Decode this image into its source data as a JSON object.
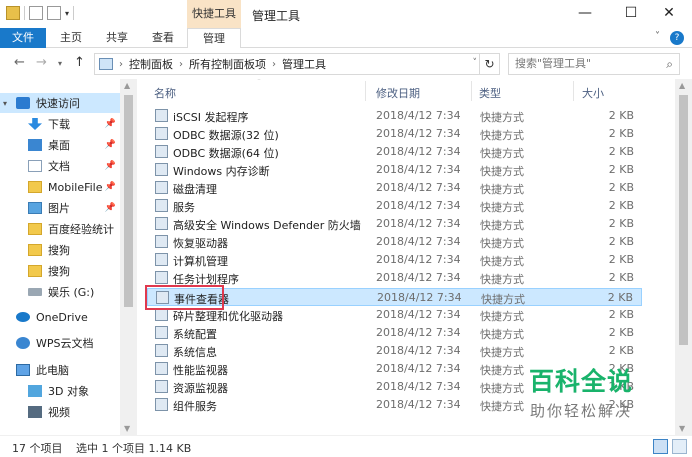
{
  "window": {
    "title": "管理工具",
    "context_tab": "快捷工具",
    "minimize_glyph": "—",
    "maximize_glyph": "☐",
    "close_glyph": "✕"
  },
  "ribbon": {
    "tabs": [
      {
        "label": "文件",
        "active": true
      },
      {
        "label": "主页"
      },
      {
        "label": "共享"
      },
      {
        "label": "查看"
      },
      {
        "label": "管理"
      }
    ],
    "collapse_glyph": "˅",
    "help_glyph": "?"
  },
  "address": {
    "segments": [
      "控制面板",
      "所有控制面板项",
      "管理工具"
    ],
    "search_placeholder": "搜索\"管理工具\""
  },
  "sidebar": {
    "items": [
      {
        "label": "快速访问",
        "icon": "star-icon",
        "selected": true
      },
      {
        "label": "下载",
        "icon": "download-icon",
        "pinned": true
      },
      {
        "label": "桌面",
        "icon": "desktop-icon",
        "pinned": true
      },
      {
        "label": "文档",
        "icon": "document-icon",
        "pinned": true
      },
      {
        "label": "MobileFile",
        "icon": "folder-icon",
        "pinned": true
      },
      {
        "label": "图片",
        "icon": "picture-icon",
        "pinned": true
      },
      {
        "label": "百度经验统计",
        "icon": "folder-icon"
      },
      {
        "label": "搜狗",
        "icon": "folder-icon"
      },
      {
        "label": "搜狗",
        "icon": "folder-icon"
      },
      {
        "label": "娱乐 (G:)",
        "icon": "drive-icon"
      },
      {
        "label": "OneDrive",
        "icon": "cloud-icon"
      },
      {
        "label": "WPS云文档",
        "icon": "wps-icon"
      },
      {
        "label": "此电脑",
        "icon": "computer-icon"
      },
      {
        "label": "3D 对象",
        "icon": "3d-objects-icon"
      },
      {
        "label": "视频",
        "icon": "video-icon"
      }
    ]
  },
  "columns": {
    "name": "名称",
    "modified": "修改日期",
    "type": "类型",
    "size": "大小"
  },
  "files": [
    {
      "name": "iSCSI 发起程序",
      "date": "2018/4/12 7:34",
      "type": "快捷方式",
      "size": "2 KB"
    },
    {
      "name": "ODBC 数据源(32 位)",
      "date": "2018/4/12 7:34",
      "type": "快捷方式",
      "size": "2 KB"
    },
    {
      "name": "ODBC 数据源(64 位)",
      "date": "2018/4/12 7:34",
      "type": "快捷方式",
      "size": "2 KB"
    },
    {
      "name": "Windows 内存诊断",
      "date": "2018/4/12 7:34",
      "type": "快捷方式",
      "size": "2 KB"
    },
    {
      "name": "磁盘清理",
      "date": "2018/4/12 7:34",
      "type": "快捷方式",
      "size": "2 KB"
    },
    {
      "name": "服务",
      "date": "2018/4/12 7:34",
      "type": "快捷方式",
      "size": "2 KB"
    },
    {
      "name": "高级安全 Windows Defender 防火墙",
      "date": "2018/4/12 7:34",
      "type": "快捷方式",
      "size": "2 KB"
    },
    {
      "name": "恢复驱动器",
      "date": "2018/4/12 7:34",
      "type": "快捷方式",
      "size": "2 KB"
    },
    {
      "name": "计算机管理",
      "date": "2018/4/12 7:34",
      "type": "快捷方式",
      "size": "2 KB"
    },
    {
      "name": "任务计划程序",
      "date": "2018/4/12 7:34",
      "type": "快捷方式",
      "size": "2 KB"
    },
    {
      "name": "事件查看器",
      "date": "2018/4/12 7:34",
      "type": "快捷方式",
      "size": "2 KB",
      "selected": true
    },
    {
      "name": "碎片整理和优化驱动器",
      "date": "2018/4/12 7:34",
      "type": "快捷方式",
      "size": "2 KB"
    },
    {
      "name": "系统配置",
      "date": "2018/4/12 7:34",
      "type": "快捷方式",
      "size": "2 KB"
    },
    {
      "name": "系统信息",
      "date": "2018/4/12 7:34",
      "type": "快捷方式",
      "size": "2 KB"
    },
    {
      "name": "性能监视器",
      "date": "2018/4/12 7:34",
      "type": "快捷方式",
      "size": "2 KB"
    },
    {
      "name": "资源监视器",
      "date": "2018/4/12 7:34",
      "type": "快捷方式",
      "size": "2 KB"
    },
    {
      "name": "组件服务",
      "date": "2018/4/12 7:34",
      "type": "快捷方式",
      "size": "2 KB"
    }
  ],
  "status": {
    "count": "17 个项目",
    "selection": "选中 1 个项目  1.14 KB"
  },
  "watermark": {
    "title": "百科全说",
    "subtitle": "助你轻松解决"
  },
  "colors": {
    "accent": "#1979ca",
    "selection": "#cce8ff",
    "highlight_box": "#e0394e",
    "watermark": "#19b36b"
  }
}
